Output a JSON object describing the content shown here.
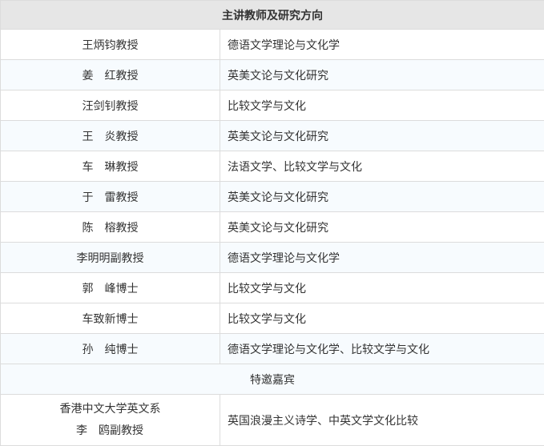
{
  "header": "主讲教师及研究方向",
  "teachers": [
    {
      "name": "王炳钧教授",
      "direction": "德语文学理论与文化学"
    },
    {
      "name": "姜　红教授",
      "direction": "英美文论与文化研究"
    },
    {
      "name": "汪剑钊教授",
      "direction": "比较文学与文化"
    },
    {
      "name": "王　炎教授",
      "direction": "英美文论与文化研究"
    },
    {
      "name": "车　琳教授",
      "direction": "法语文学、比较文学与文化"
    },
    {
      "name": "于　雷教授",
      "direction": "英美文论与文化研究"
    },
    {
      "name": "陈　榕教授",
      "direction": "英美文论与文化研究"
    },
    {
      "name": "李明明副教授",
      "direction": "德语文学理论与文化学"
    },
    {
      "name": "郭　峰博士",
      "direction": "比较文学与文化"
    },
    {
      "name": "车致新博士",
      "direction": "比较文学与文化"
    },
    {
      "name": "孙　纯博士",
      "direction": "德语文学理论与文化学、比较文学与文化"
    }
  ],
  "guest_section": "特邀嘉宾",
  "guest": {
    "affiliation": "香港中文大学英文系",
    "name": "李　鸥副教授",
    "direction": "英国浪漫主义诗学、中英文学文化比较"
  }
}
